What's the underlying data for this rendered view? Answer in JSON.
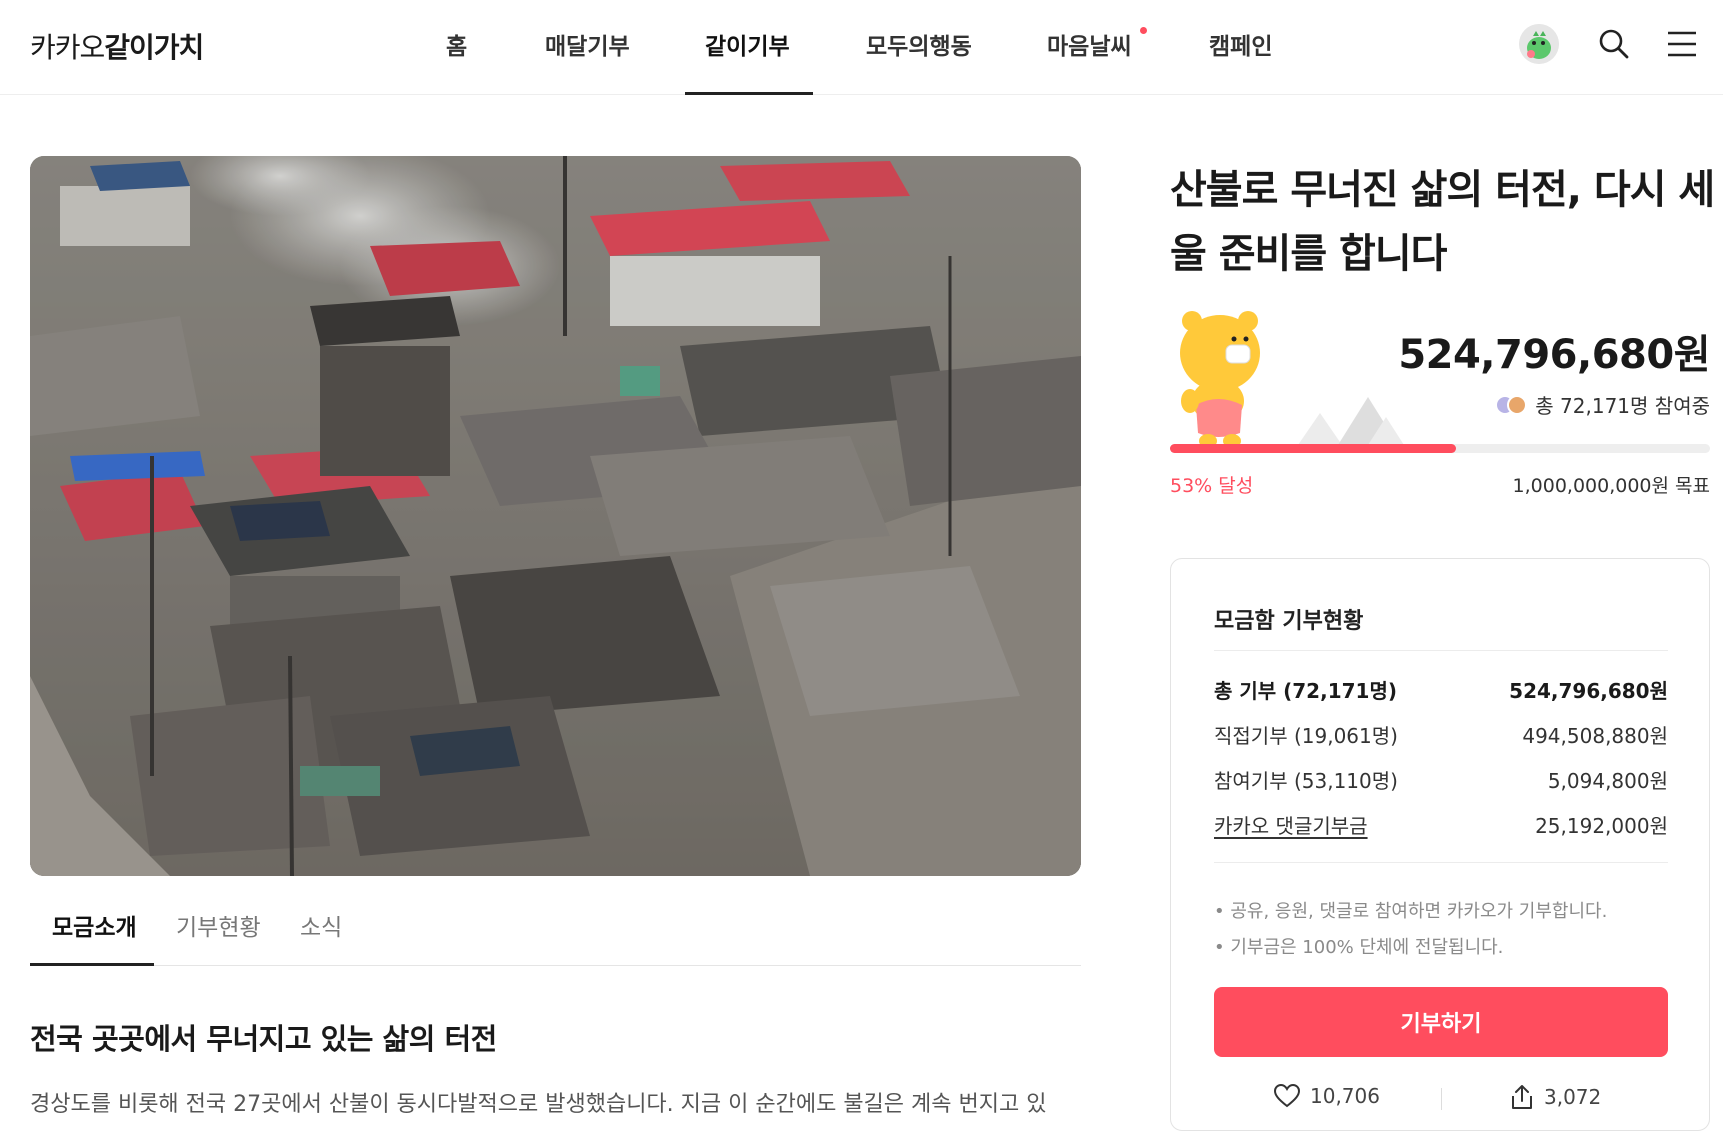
{
  "header": {
    "logo_light": "카카오",
    "logo_bold": "같이가치",
    "nav": [
      {
        "label": "홈"
      },
      {
        "label": "매달기부"
      },
      {
        "label": "같이기부"
      },
      {
        "label": "모두의행동"
      },
      {
        "label": "마음날씨"
      },
      {
        "label": "캠페인"
      }
    ],
    "icons": {
      "search": "search-icon",
      "menu": "menu-icon"
    }
  },
  "tabs": [
    {
      "label": "모금소개"
    },
    {
      "label": "기부현황"
    },
    {
      "label": "소식"
    }
  ],
  "intro": {
    "title": "전국 곳곳에서 무너지고 있는 삶의 터전",
    "body": "경상도를 비롯해 전국 27곳에서 산불이 동시다발적으로 발생했습니다. 지금 이 순간에도 불길은 계속 번지고 있"
  },
  "campaign": {
    "title": "산불로 무너진 삶의 터전, 다시 세울 준비를 합니다",
    "amount": "524,796,680원",
    "participants": "총 72,171명 참여중",
    "progress_text": "53% 달성",
    "progress_fraction": 0.53,
    "goal": "1,000,000,000원 목표"
  },
  "summary": {
    "title": "모금함 기부현황",
    "rows": [
      {
        "label": "총 기부 (72,171명)",
        "value": "524,796,680원"
      },
      {
        "label": "직접기부 (19,061명)",
        "value": "494,508,880원"
      },
      {
        "label": "참여기부 (53,110명)",
        "value": "5,094,800원"
      },
      {
        "label": "카카오 댓글기부금",
        "value": "25,192,000원"
      }
    ],
    "notes": [
      "• 공유, 응원, 댓글로 참여하면 카카오가 기부합니다.",
      "• 기부금은 100% 단체에 전달됩니다."
    ],
    "donate_label": "기부하기",
    "likes": "10,706",
    "shares": "3,072"
  },
  "colors": {
    "accent": "#ff4d5e",
    "text": "#222222"
  }
}
